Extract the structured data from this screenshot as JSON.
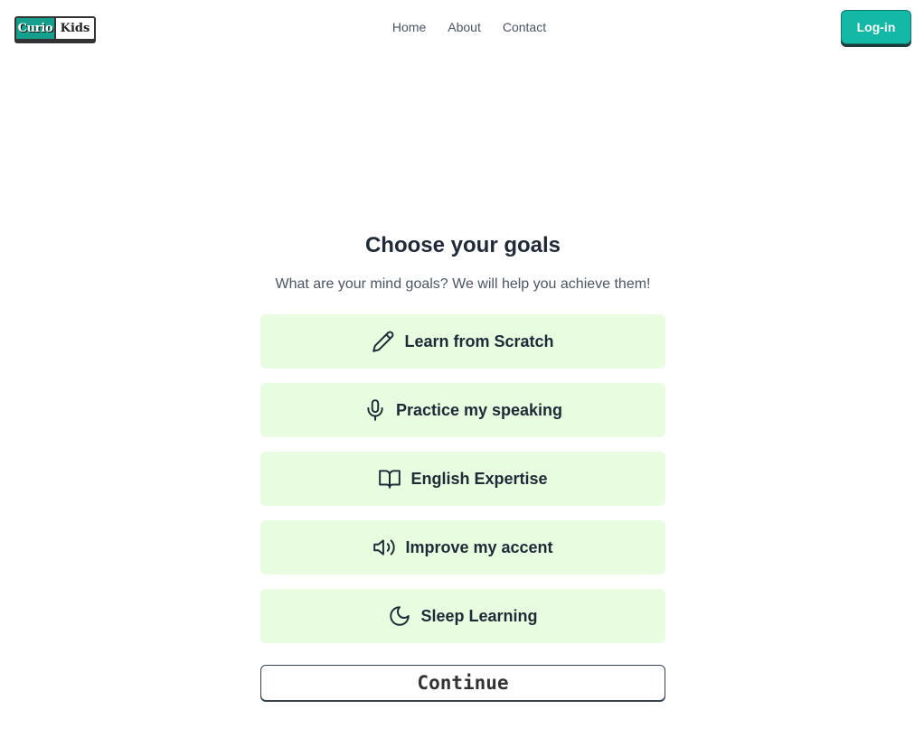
{
  "header": {
    "logo_part1": "Curio",
    "logo_part2": "Kids",
    "nav": [
      "Home",
      "About",
      "Contact"
    ],
    "login_label": "Log-in"
  },
  "main": {
    "title": "Choose your goals",
    "subtitle": "What are your mind goals? We will help you achieve them!",
    "goals": [
      {
        "label": "Learn from Scratch",
        "icon": "pencil-icon"
      },
      {
        "label": "Practice my speaking",
        "icon": "microphone-icon"
      },
      {
        "label": "English Expertise",
        "icon": "book-open-icon"
      },
      {
        "label": "Improve my accent",
        "icon": "speaker-icon"
      },
      {
        "label": "Sleep Learning",
        "icon": "moon-icon"
      }
    ],
    "continue_label": "Continue"
  },
  "colors": {
    "accent": "#14b8a6",
    "goal_bg": "#e8fde0",
    "logo_green": "#14a08c"
  }
}
